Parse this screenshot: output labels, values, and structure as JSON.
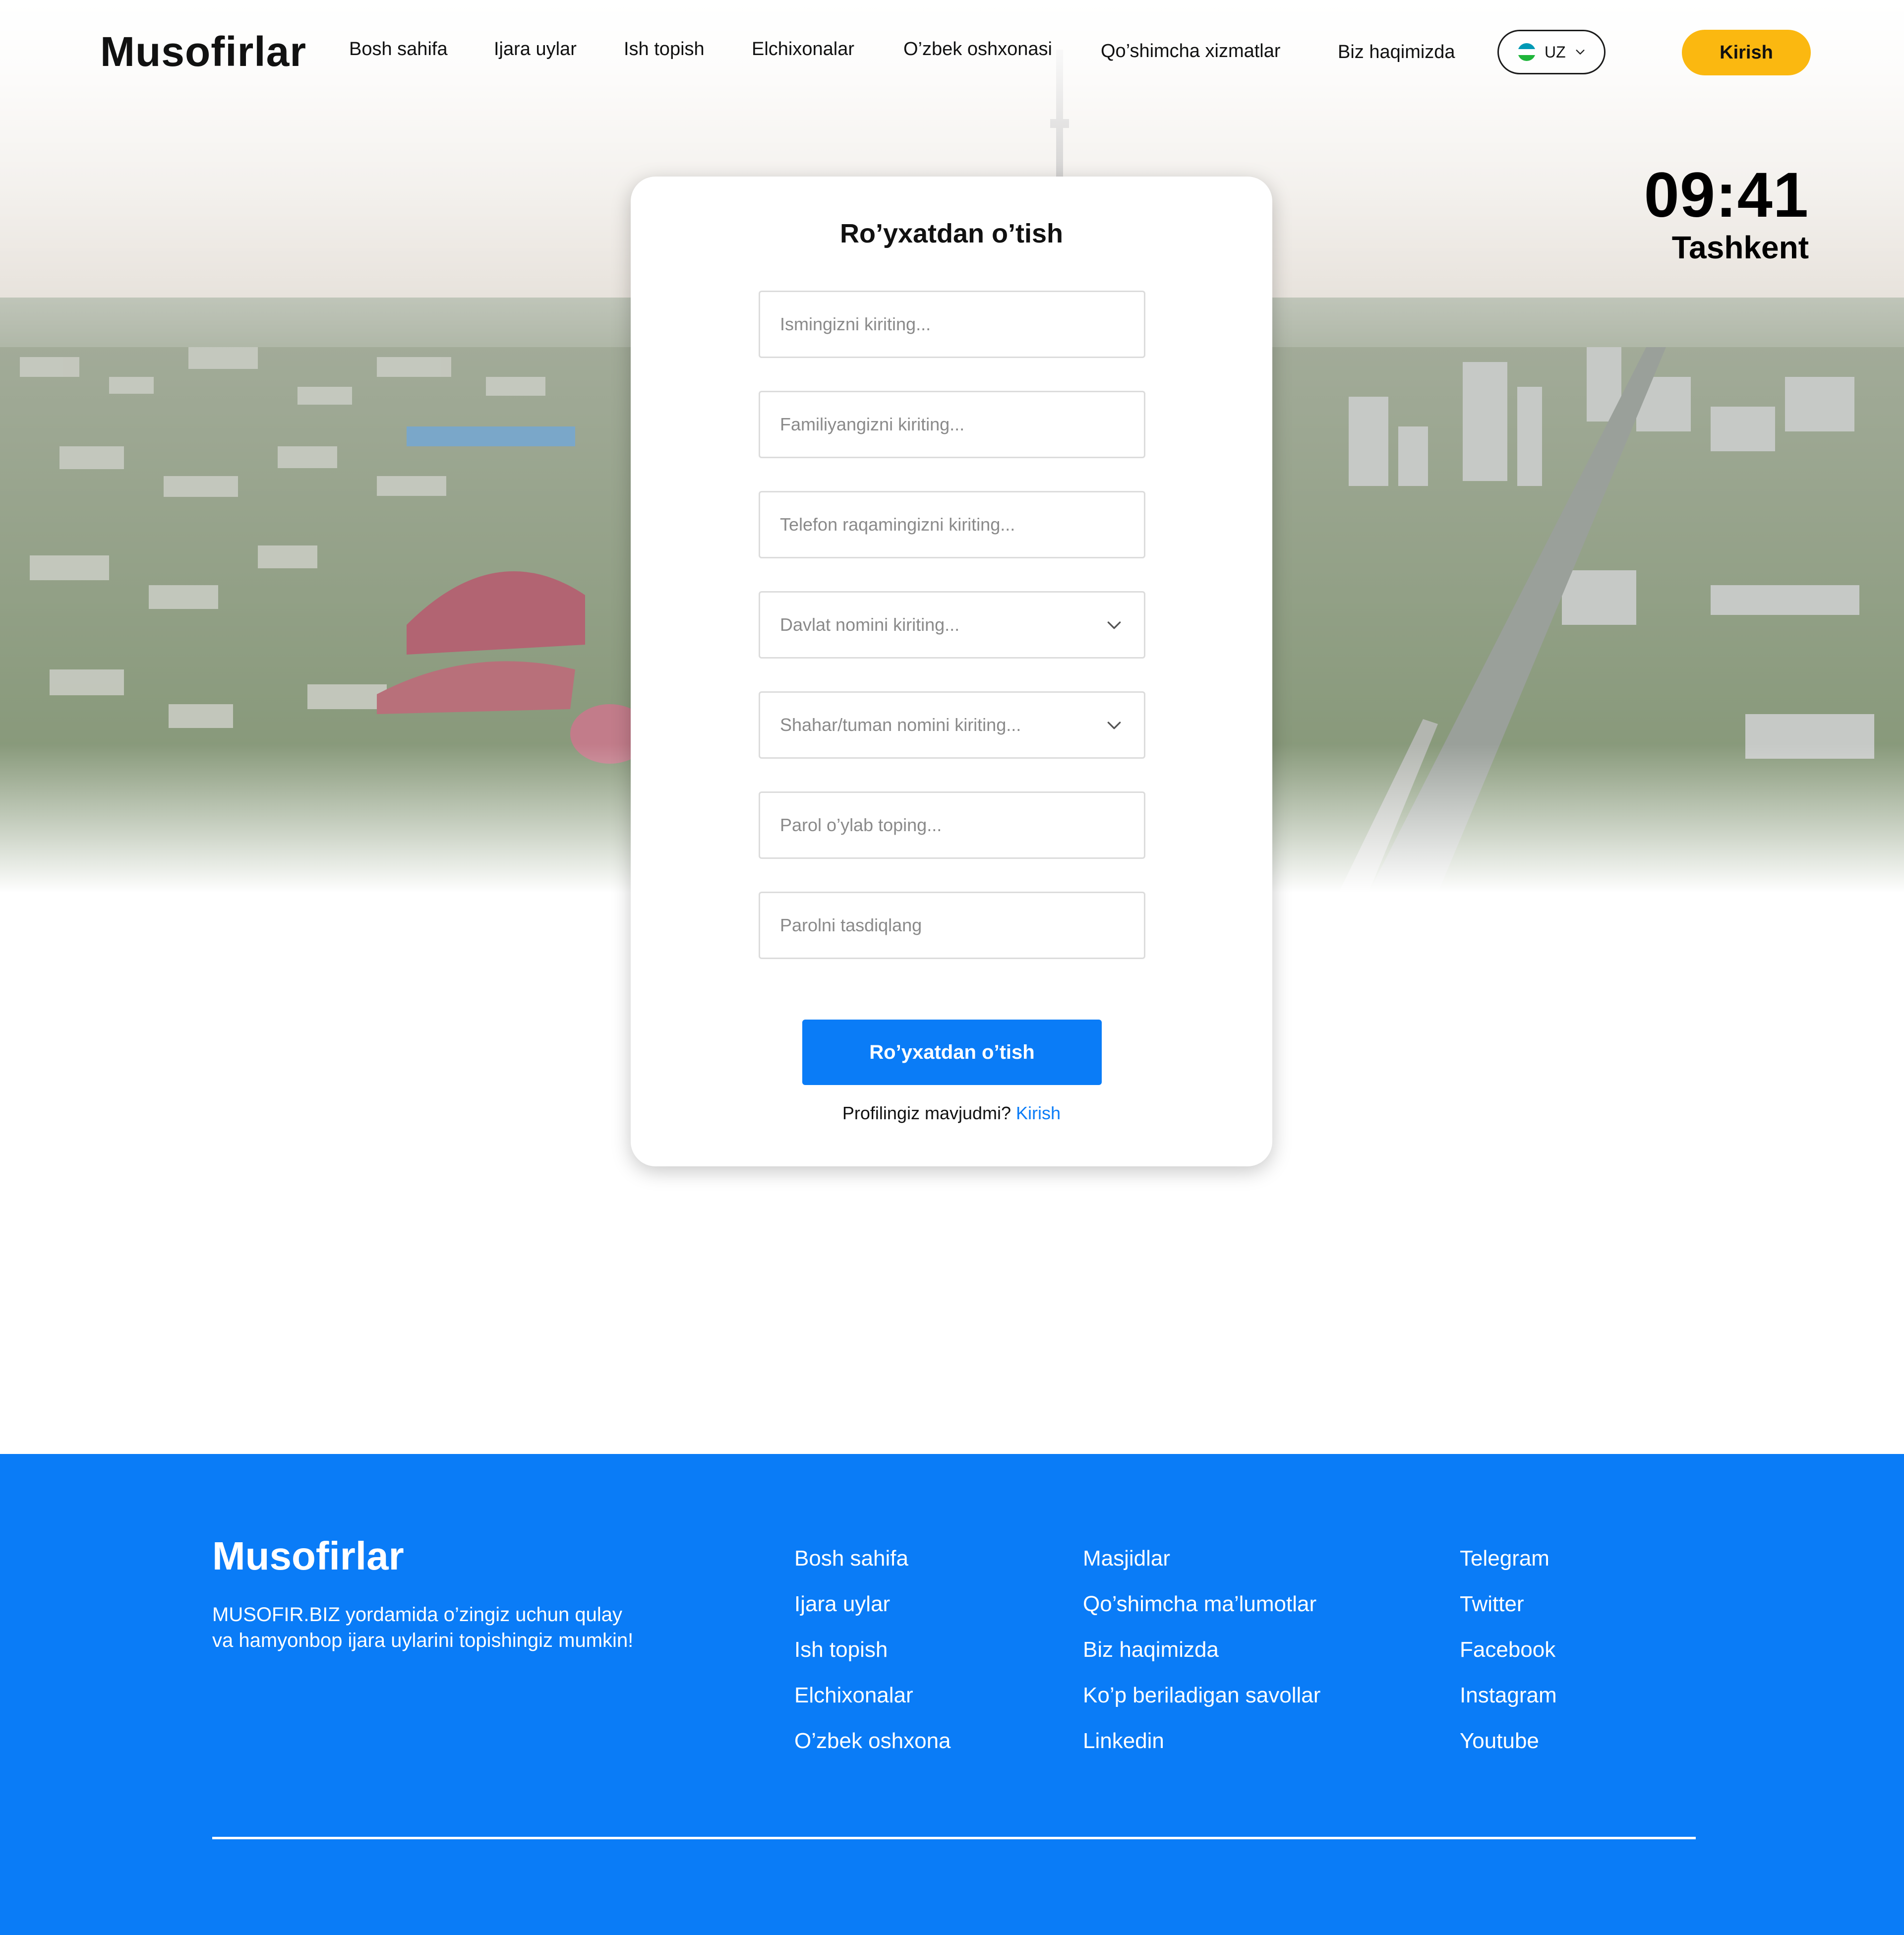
{
  "header": {
    "logo": "Musofirlar",
    "nav": [
      "Bosh sahifa",
      "Ijara uylar",
      "Ish topish",
      "Elchixonalar",
      "O’zbek oshxonasi",
      "Qo’shimcha xizmatlar",
      "Biz haqimizda"
    ],
    "language": "UZ",
    "flag_colors": [
      "#1EB53A",
      "#ffffff",
      "#0099B5"
    ],
    "login_label": "Kirish"
  },
  "clock": {
    "time": "09:41",
    "city": "Tashkent"
  },
  "form": {
    "title": "Ro’yxatdan o’tish",
    "fields": [
      {
        "placeholder": "Ismingizni kiriting...",
        "type": "text"
      },
      {
        "placeholder": "Familiyangizni kiriting...",
        "type": "text"
      },
      {
        "placeholder": "Telefon raqamingizni kiriting...",
        "type": "tel"
      },
      {
        "placeholder": "Davlat nomini kiriting...",
        "type": "select"
      },
      {
        "placeholder": "Shahar/tuman nomini kiriting...",
        "type": "select"
      },
      {
        "placeholder": "Parol o’ylab toping...",
        "type": "password"
      },
      {
        "placeholder": "Parolni tasdiqlang",
        "type": "password"
      }
    ],
    "submit_label": "Ro’yxatdan o’tish",
    "signin_prompt": "Profilingiz mavjudmi?",
    "signin_link": "Kirish"
  },
  "footer": {
    "logo": "Musofirlar",
    "description": "MUSOFIR.BIZ yordamida o’zingiz uchun qulay va hamyonbop ijara uylarini topishingiz mumkin!",
    "col1": [
      "Bosh sahifa",
      "Ijara uylar",
      "Ish topish",
      "Elchixonalar",
      "O’zbek oshxona"
    ],
    "col2": [
      "Masjidlar",
      "Qo’shimcha ma’lumotlar",
      "Biz haqimizda",
      "Ko’p beriladigan savollar",
      "Linkedin"
    ],
    "col3": [
      "Telegram",
      "Twitter",
      "Facebook",
      "Instagram",
      "Youtube"
    ]
  },
  "colors": {
    "accent_blue": "#0A7CF7",
    "login_yellow": "#FBB810"
  }
}
